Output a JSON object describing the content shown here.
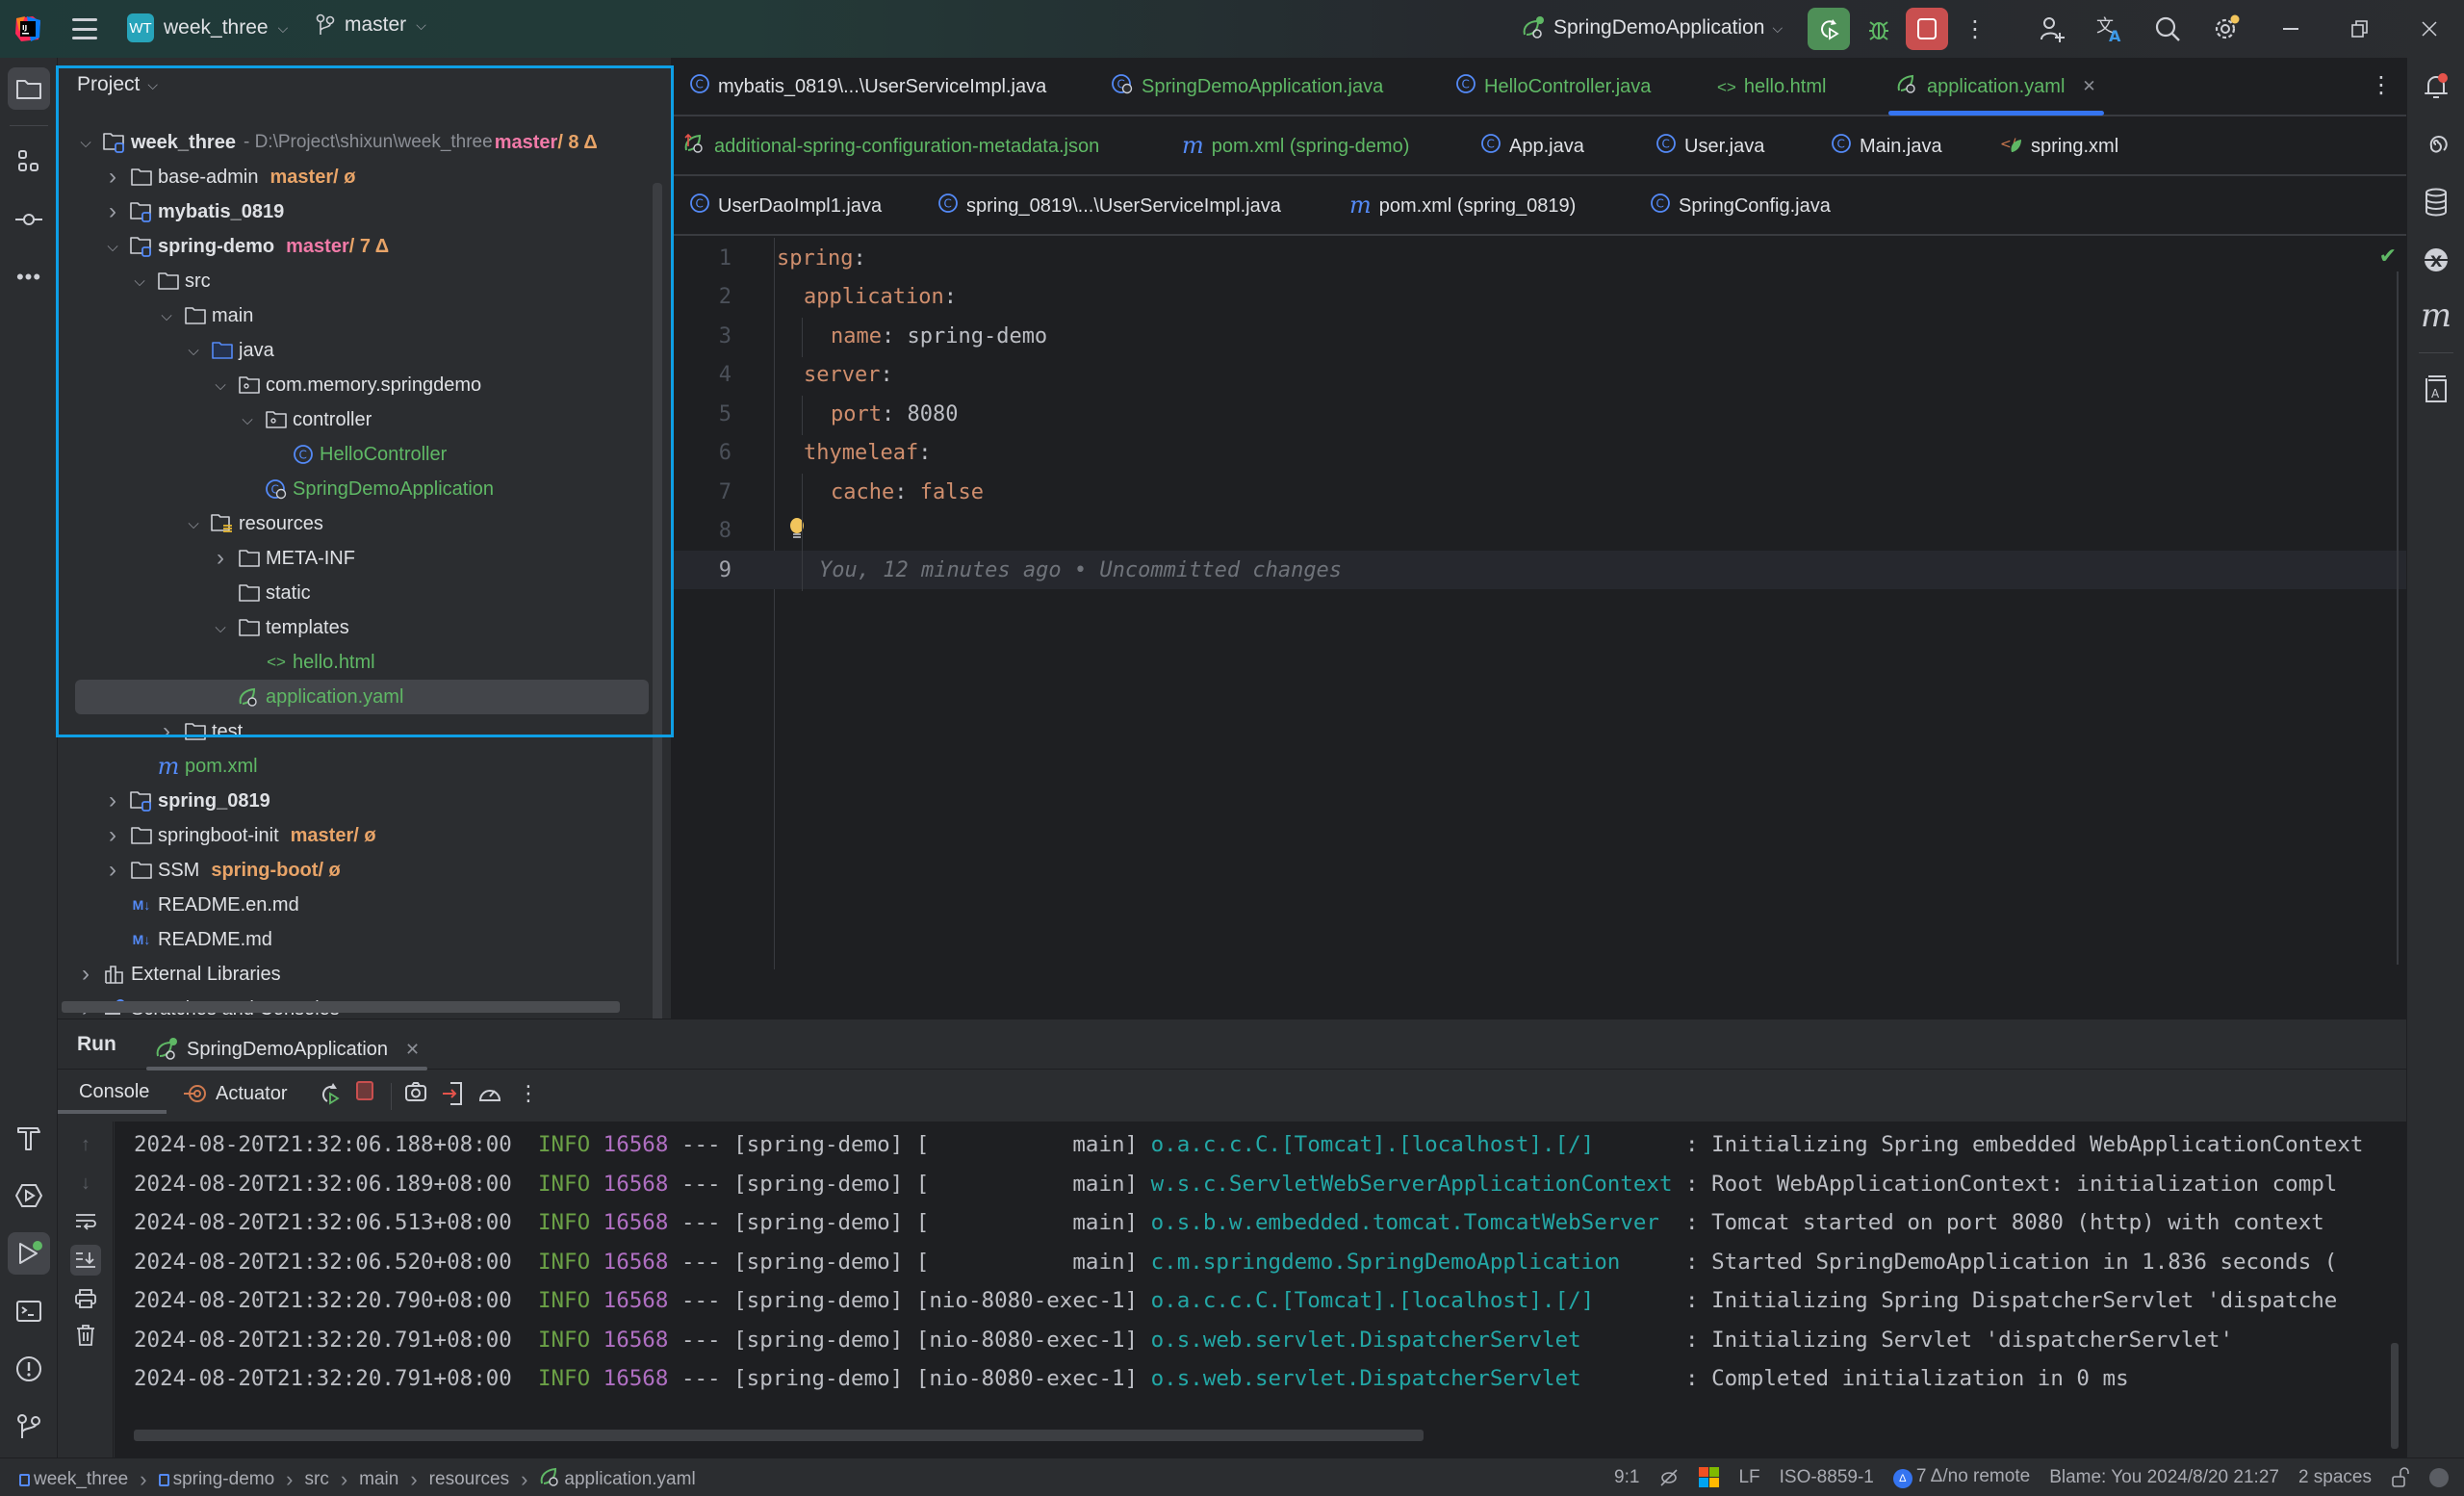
{
  "titlebar": {
    "project_badge": "WT",
    "project_name": "week_three",
    "branch": "master",
    "run_config": "SpringDemoApplication",
    "icons": [
      "app-logo-icon",
      "main-menu-icon",
      "branch-icon",
      "run-config-icon",
      "rerun-icon",
      "debug-icon",
      "stop-icon",
      "more-icon",
      "add-user-icon",
      "translate-icon",
      "search-icon",
      "settings-icon",
      "minimize-icon",
      "restore-icon",
      "close-icon"
    ]
  },
  "left_toolbar": {
    "top": [
      "project-folder-icon",
      "structure-icon",
      "commit-icon",
      "more-tools-icon"
    ],
    "bottom": [
      "build-hammer-icon",
      "services-icon",
      "run-icon",
      "terminal-icon",
      "problems-icon",
      "git-icon"
    ]
  },
  "right_toolbar": [
    "notifications-icon",
    "ai-assistant-icon",
    "database-icon",
    "xpath-icon",
    "maven-icon",
    "bookmarks-icon"
  ],
  "project": {
    "header": "Project",
    "tree": [
      {
        "depth": 0,
        "arrow": "down",
        "icon": "module",
        "name": "week_three",
        "bold": true,
        "path": " - D:\\Project\\shixun\\week_three",
        "vcs_branch": "master",
        "vcs_branch_color": "#f17aa8",
        "vcs_rest": " / 8 Δ"
      },
      {
        "depth": 1,
        "arrow": "right",
        "icon": "folder",
        "name": "base-admin",
        "vcs_branch": "master",
        "vcs_branch_color": "#e8a468",
        "vcs_rest": " / ø"
      },
      {
        "depth": 1,
        "arrow": "right",
        "icon": "module",
        "name": "mybatis_0819",
        "bold": true
      },
      {
        "depth": 1,
        "arrow": "down",
        "icon": "module",
        "name": "spring-demo",
        "bold": true,
        "vcs_branch": "master",
        "vcs_branch_color": "#f17aa8",
        "vcs_rest": " / 7 Δ"
      },
      {
        "depth": 2,
        "arrow": "down",
        "icon": "folder",
        "name": "src"
      },
      {
        "depth": 3,
        "arrow": "down",
        "icon": "folder",
        "name": "main"
      },
      {
        "depth": 4,
        "arrow": "down",
        "icon": "source-folder",
        "name": "java"
      },
      {
        "depth": 5,
        "arrow": "down",
        "icon": "package",
        "name": "com.memory.springdemo"
      },
      {
        "depth": 6,
        "arrow": "down",
        "icon": "package",
        "name": "controller"
      },
      {
        "depth": 7,
        "arrow": "",
        "icon": "class",
        "name": "HelloController",
        "green": true
      },
      {
        "depth": 6,
        "arrow": "",
        "icon": "spring-class",
        "name": "SpringDemoApplication",
        "green": true
      },
      {
        "depth": 4,
        "arrow": "down",
        "icon": "resources-folder",
        "name": "resources"
      },
      {
        "depth": 5,
        "arrow": "right",
        "icon": "folder",
        "name": "META-INF"
      },
      {
        "depth": 5,
        "arrow": "",
        "icon": "folder",
        "name": "static"
      },
      {
        "depth": 5,
        "arrow": "down",
        "icon": "folder",
        "name": "templates"
      },
      {
        "depth": 6,
        "arrow": "",
        "icon": "html",
        "name": "hello.html",
        "green": true
      },
      {
        "depth": 5,
        "arrow": "",
        "icon": "spring-yaml",
        "name": "application.yaml",
        "green": true,
        "selected": true
      },
      {
        "depth": 3,
        "arrow": "right",
        "icon": "folder",
        "name": "test"
      },
      {
        "depth": 2,
        "arrow": "",
        "icon": "maven",
        "name": "pom.xml",
        "green": true
      },
      {
        "depth": 1,
        "arrow": "right",
        "icon": "module",
        "name": "spring_0819",
        "bold": true
      },
      {
        "depth": 1,
        "arrow": "right",
        "icon": "folder",
        "name": "springboot-init",
        "vcs_branch": "master",
        "vcs_branch_color": "#e8a468",
        "vcs_rest": " / ø"
      },
      {
        "depth": 1,
        "arrow": "right",
        "icon": "folder",
        "name": "SSM",
        "vcs_branch": "spring-boot",
        "vcs_branch_color": "#e8a468",
        "vcs_rest": " / ø"
      },
      {
        "depth": 1,
        "arrow": "",
        "icon": "markdown",
        "name": "README.en.md"
      },
      {
        "depth": 1,
        "arrow": "",
        "icon": "markdown",
        "name": "README.md"
      },
      {
        "depth": 0,
        "arrow": "right",
        "icon": "libraries",
        "name": "External Libraries"
      },
      {
        "depth": 0,
        "arrow": "right",
        "icon": "scratches",
        "name": "Scratches and Consoles"
      }
    ]
  },
  "editor": {
    "tab_rows": [
      [
        {
          "label": "mybatis_0819\\...\\UserServiceImpl.java",
          "icon": "class"
        },
        {
          "label": "SpringDemoApplication.java",
          "icon": "spring-class",
          "green": true
        },
        {
          "label": "HelloController.java",
          "icon": "class",
          "green": true
        },
        {
          "label": "hello.html",
          "icon": "html",
          "green": true
        },
        {
          "label": "application.yaml",
          "icon": "spring-yaml",
          "green": true,
          "active": true,
          "closable": true
        }
      ],
      [
        {
          "label": "additional-spring-configuration-metadata.json",
          "icon": "spring-json",
          "green": true
        },
        {
          "label": "pom.xml (spring-demo)",
          "icon": "maven",
          "green": true
        },
        {
          "label": "App.java",
          "icon": "class"
        },
        {
          "label": "User.java",
          "icon": "class"
        },
        {
          "label": "Main.java",
          "icon": "class"
        },
        {
          "label": "spring.xml",
          "icon": "spring-xml"
        }
      ],
      [
        {
          "label": "UserDaoImpl1.java",
          "icon": "class"
        },
        {
          "label": "spring_0819\\...\\UserServiceImpl.java",
          "icon": "class"
        },
        {
          "label": "pom.xml (spring_0819)",
          "icon": "maven"
        },
        {
          "label": "SpringConfig.java",
          "icon": "class"
        }
      ]
    ],
    "lines": [
      {
        "n": "1",
        "indent": 0,
        "key": "spring",
        "value": ""
      },
      {
        "n": "2",
        "indent": 1,
        "key": "application",
        "value": ""
      },
      {
        "n": "3",
        "indent": 2,
        "key": "name",
        "value": "spring-demo",
        "vtype": "str"
      },
      {
        "n": "4",
        "indent": 1,
        "key": "server",
        "value": ""
      },
      {
        "n": "5",
        "indent": 2,
        "key": "port",
        "value": "8080",
        "vtype": "str"
      },
      {
        "n": "6",
        "indent": 1,
        "key": "thymeleaf",
        "value": ""
      },
      {
        "n": "7",
        "indent": 2,
        "key": "cache",
        "value": "false",
        "vtype": "bool"
      },
      {
        "n": "8",
        "indent": 0,
        "key": "",
        "value": "",
        "bulb": true
      },
      {
        "n": "9",
        "indent": 0,
        "key": "",
        "value": "",
        "current": true,
        "inlay": "You, 12 minutes ago • Uncommitted changes"
      }
    ],
    "inspection_status": "no-problems-check-icon"
  },
  "run_panel": {
    "title": "Run",
    "tab_label": "SpringDemoApplication",
    "console_tab": "Console",
    "actuator_tab": "Actuator",
    "log": [
      {
        "ts": "2024-08-20T21:32:06.188+08:00",
        "level": "INFO",
        "pid": "16568",
        "sep": " --- ",
        "app": "[spring-demo]",
        "thread": "[           main]",
        "logger": "o.a.c.c.C.[Tomcat].[localhost].[/]      ",
        "msg": " : Initializing Spring embedded WebApplicationContext"
      },
      {
        "ts": "2024-08-20T21:32:06.189+08:00",
        "level": "INFO",
        "pid": "16568",
        "sep": " --- ",
        "app": "[spring-demo]",
        "thread": "[           main]",
        "logger": "w.s.c.ServletWebServerApplicationContext",
        "msg": " : Root WebApplicationContext: initialization compl"
      },
      {
        "ts": "2024-08-20T21:32:06.513+08:00",
        "level": "INFO",
        "pid": "16568",
        "sep": " --- ",
        "app": "[spring-demo]",
        "thread": "[           main]",
        "logger": "o.s.b.w.embedded.tomcat.TomcatWebServer ",
        "msg": " : Tomcat started on port 8080 (http) with context "
      },
      {
        "ts": "2024-08-20T21:32:06.520+08:00",
        "level": "INFO",
        "pid": "16568",
        "sep": " --- ",
        "app": "[spring-demo]",
        "thread": "[           main]",
        "logger": "c.m.springdemo.SpringDemoApplication    ",
        "msg": " : Started SpringDemoApplication in 1.836 seconds ("
      },
      {
        "ts": "2024-08-20T21:32:20.790+08:00",
        "level": "INFO",
        "pid": "16568",
        "sep": " --- ",
        "app": "[spring-demo]",
        "thread": "[nio-8080-exec-1]",
        "logger": "o.a.c.c.C.[Tomcat].[localhost].[/]      ",
        "msg": " : Initializing Spring DispatcherServlet 'dispatche"
      },
      {
        "ts": "2024-08-20T21:32:20.791+08:00",
        "level": "INFO",
        "pid": "16568",
        "sep": " --- ",
        "app": "[spring-demo]",
        "thread": "[nio-8080-exec-1]",
        "logger": "o.s.web.servlet.DispatcherServlet       ",
        "msg": " : Initializing Servlet 'dispatcherServlet'"
      },
      {
        "ts": "2024-08-20T21:32:20.791+08:00",
        "level": "INFO",
        "pid": "16568",
        "sep": " --- ",
        "app": "[spring-demo]",
        "thread": "[nio-8080-exec-1]",
        "logger": "o.s.web.servlet.DispatcherServlet       ",
        "msg": " : Completed initialization in 0 ms"
      }
    ]
  },
  "statusbar": {
    "breadcrumbs": [
      {
        "label": "week_three",
        "icon": "module"
      },
      {
        "label": "spring-demo",
        "icon": "module"
      },
      {
        "label": "src"
      },
      {
        "label": "main"
      },
      {
        "label": "resources"
      },
      {
        "label": "application.yaml",
        "icon": "spring-yaml"
      }
    ],
    "position": "9:1",
    "line_separator": "LF",
    "encoding": "ISO-8859-1",
    "vcs": "7 Δ/no remote",
    "blame": "Blame: You 2024/8/20 21:27",
    "indent": "2 spaces"
  },
  "colors": {
    "accent": "#3574f0",
    "focus_border": "#0e9fe6",
    "run_green": "#4e8f57",
    "stop_red": "#c94f4f",
    "modified_green": "#5fb865"
  }
}
